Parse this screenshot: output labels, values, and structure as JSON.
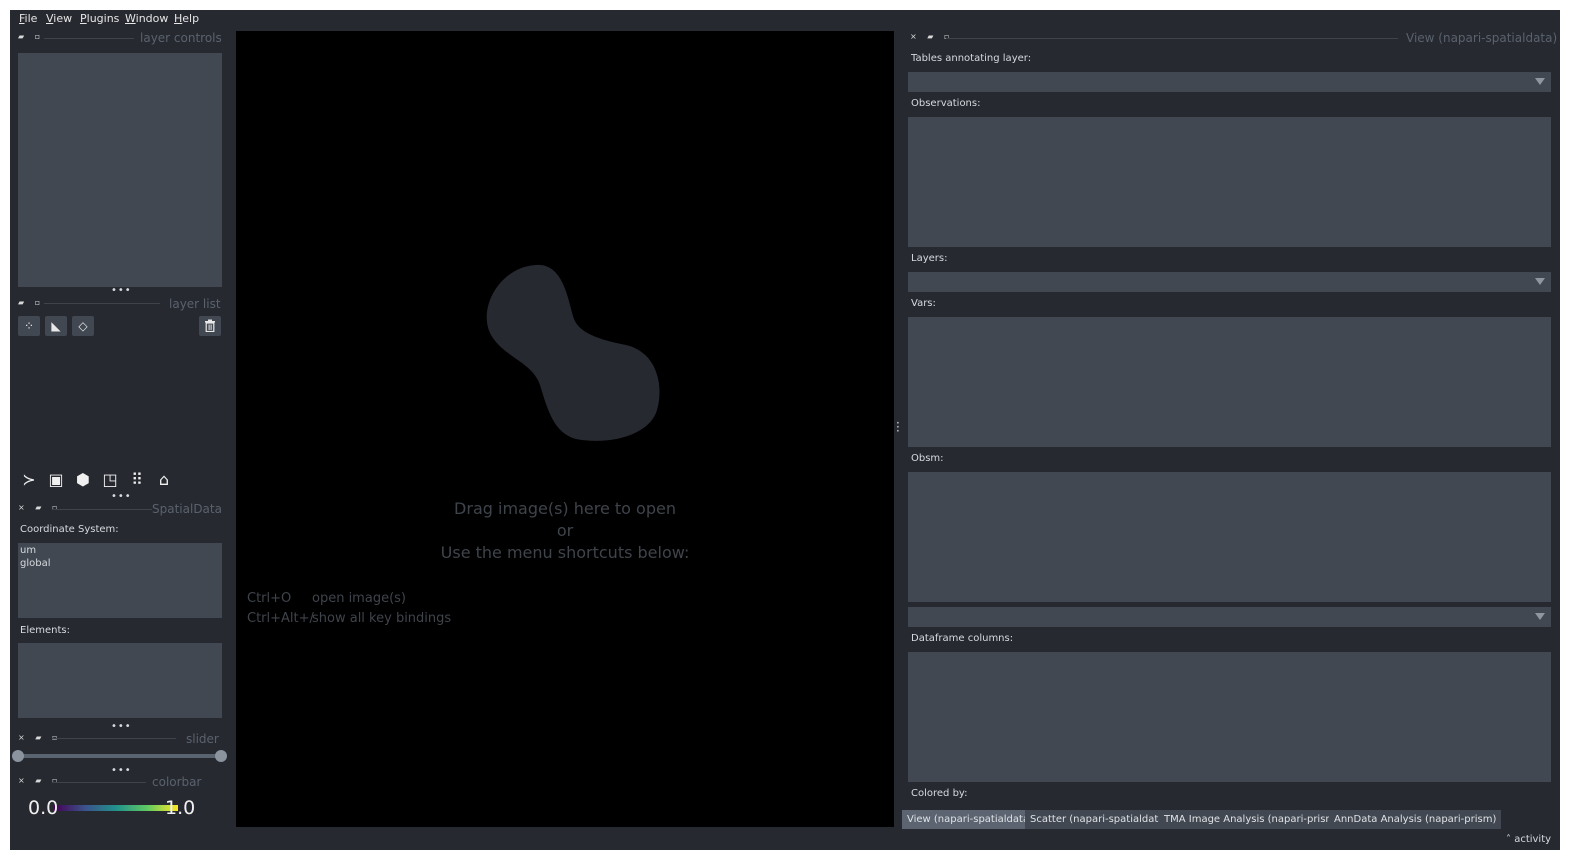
{
  "menu": [
    "File",
    "View",
    "Plugins",
    "Window",
    "Help"
  ],
  "left": {
    "layer_controls_title": "layer controls",
    "layer_list_title": "layer list",
    "spatialdata_title": "SpatialData",
    "coordinate_system_label": "Coordinate System:",
    "coordinate_systems": [
      "um",
      "global"
    ],
    "elements_label": "Elements:",
    "slider_title": "slider",
    "colorbar_title": "colorbar",
    "colorbar_min": "0.0",
    "colorbar_max": "1.0",
    "layer_buttons": [
      "points-icon",
      "shapes-icon",
      "labels-icon"
    ],
    "viewer_buttons": [
      "console-icon",
      "ndisplay-icon",
      "roll-icon",
      "transpose-icon",
      "grid-icon",
      "home-icon"
    ]
  },
  "canvas": {
    "drop_line1": "Drag image(s) here to open",
    "drop_line2": "or",
    "drop_line3": "Use the menu shortcuts below:",
    "shortcuts": [
      {
        "key": "Ctrl+O",
        "action": "open image(s)"
      },
      {
        "key": "Ctrl+Alt+/",
        "action": "show all key bindings"
      }
    ]
  },
  "right": {
    "title": "View (napari-spatialdata)",
    "tables_label": "Tables annotating layer:",
    "observations_label": "Observations:",
    "layers_label": "Layers:",
    "vars_label": "Vars:",
    "obsm_label": "Obsm:",
    "dataframe_label": "Dataframe columns:",
    "colored_by_label": "Colored by:",
    "tabs": [
      "View (napari-spatialdata)",
      "Scatter (napari-spatialdata)",
      "TMA Image Analysis (napari-prism)",
      "AnnData Analysis (napari-prism)"
    ]
  },
  "status": {
    "activity": "activity"
  },
  "colors": {
    "window_bg": "#262930",
    "panel_bg": "#414851",
    "canvas_bg": "#000000",
    "logo": "#262930"
  }
}
